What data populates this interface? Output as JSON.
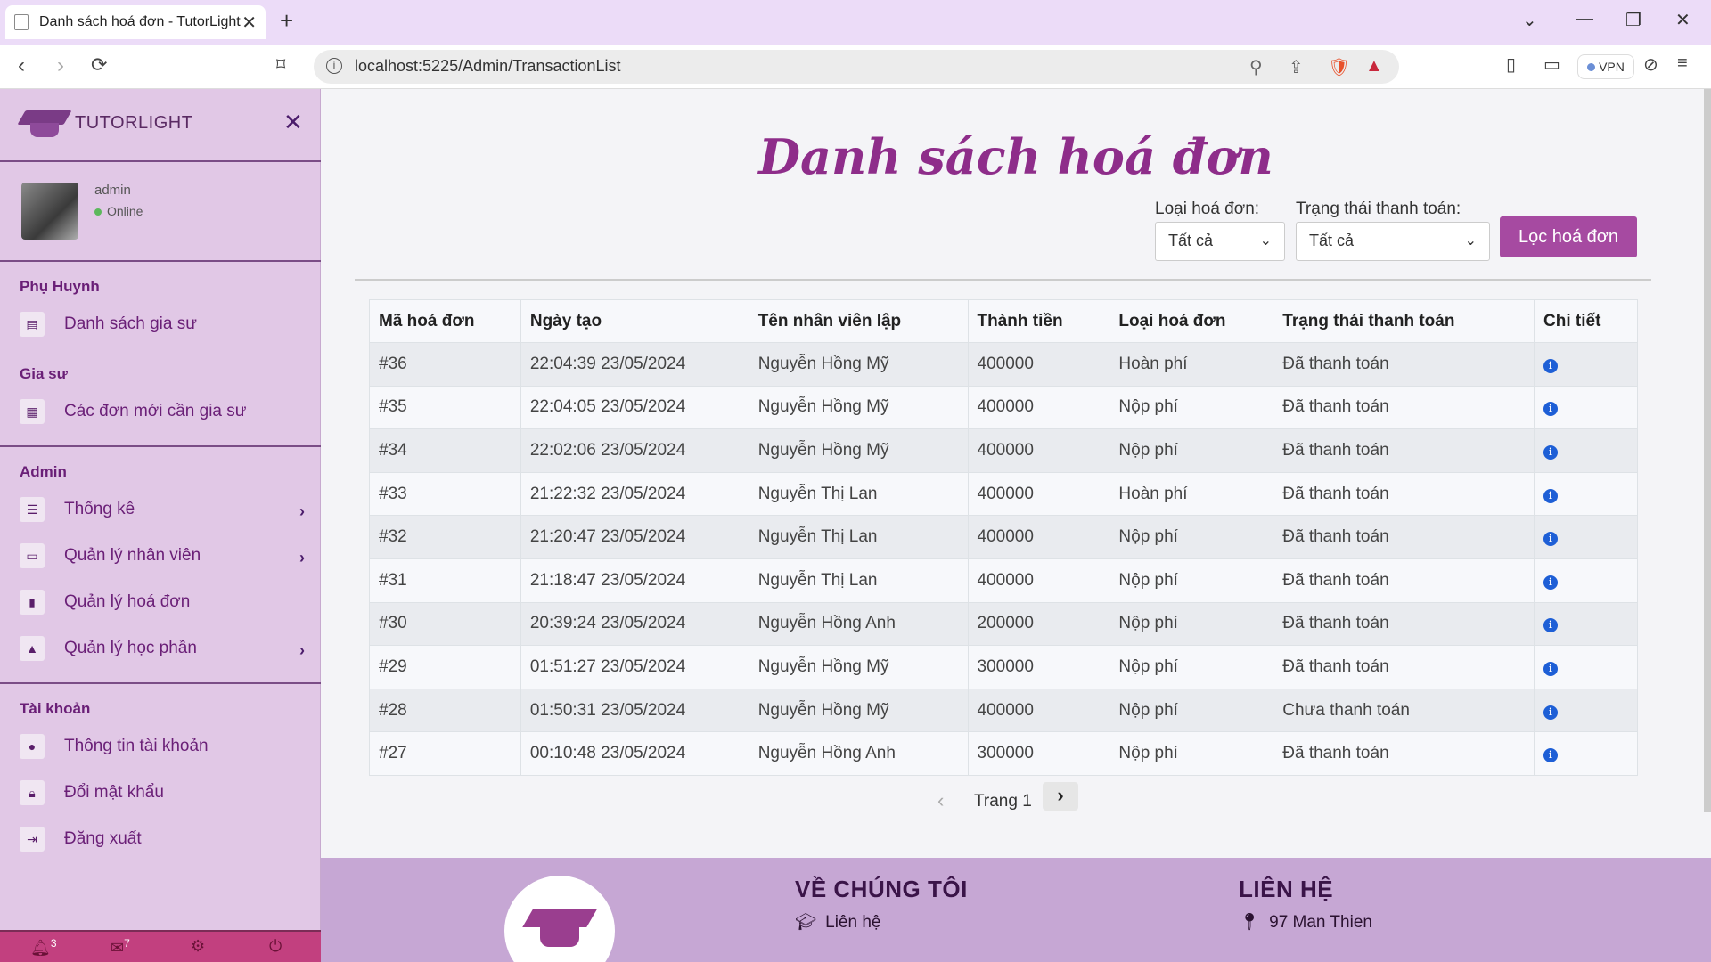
{
  "browser": {
    "tab_title": "Danh sách hoá đơn - TutorLight",
    "url": "localhost:5225/Admin/TransactionList",
    "vpn_label": "VPN"
  },
  "sidebar": {
    "brand": "TUTORLIGHT",
    "user_name": "admin",
    "user_status": "Online",
    "sections": [
      {
        "title": "Phụ Huynh",
        "items": [
          {
            "label": "Danh sách gia sư"
          }
        ]
      },
      {
        "title": "Gia sư",
        "items": [
          {
            "label": "Các đơn mới cần gia sư"
          }
        ]
      },
      {
        "title": "Admin",
        "items": [
          {
            "label": "Thống kê"
          },
          {
            "label": "Quản lý nhân viên"
          },
          {
            "label": "Quản lý hoá đơn"
          },
          {
            "label": "Quản lý học phần"
          }
        ]
      },
      {
        "title": "Tài khoản",
        "items": [
          {
            "label": "Thông tin tài khoản"
          },
          {
            "label": "Đổi mật khẩu"
          },
          {
            "label": "Đăng xuất"
          }
        ]
      }
    ],
    "footer": {
      "notifications_count": "3",
      "messages_count": "7"
    }
  },
  "main": {
    "title": "Danh sách hoá đơn",
    "filters": {
      "type_label": "Loại hoá đơn:",
      "type_value": "Tất cả",
      "status_label": "Trạng thái thanh toán:",
      "status_value": "Tất cả",
      "submit_label": "Lọc hoá đơn"
    },
    "table": {
      "headers": [
        "Mã hoá đơn",
        "Ngày tạo",
        "Tên nhân viên lập",
        "Thành tiền",
        "Loại hoá đơn",
        "Trạng thái thanh toán",
        "Chi tiết"
      ],
      "rows": [
        [
          "#36",
          "22:04:39 23/05/2024",
          "Nguyễn Hồng Mỹ",
          "400000",
          "Hoàn phí",
          "Đã thanh toán"
        ],
        [
          "#35",
          "22:04:05 23/05/2024",
          "Nguyễn Hồng Mỹ",
          "400000",
          "Nộp phí",
          "Đã thanh toán"
        ],
        [
          "#34",
          "22:02:06 23/05/2024",
          "Nguyễn Hồng Mỹ",
          "400000",
          "Nộp phí",
          "Đã thanh toán"
        ],
        [
          "#33",
          "21:22:32 23/05/2024",
          "Nguyễn Thị Lan",
          "400000",
          "Hoàn phí",
          "Đã thanh toán"
        ],
        [
          "#32",
          "21:20:47 23/05/2024",
          "Nguyễn Thị Lan",
          "400000",
          "Nộp phí",
          "Đã thanh toán"
        ],
        [
          "#31",
          "21:18:47 23/05/2024",
          "Nguyễn Thị Lan",
          "400000",
          "Nộp phí",
          "Đã thanh toán"
        ],
        [
          "#30",
          "20:39:24 23/05/2024",
          "Nguyễn Hồng Anh",
          "200000",
          "Nộp phí",
          "Đã thanh toán"
        ],
        [
          "#29",
          "01:51:27 23/05/2024",
          "Nguyễn Hồng Mỹ",
          "300000",
          "Nộp phí",
          "Đã thanh toán"
        ],
        [
          "#28",
          "01:50:31 23/05/2024",
          "Nguyễn Hồng Mỹ",
          "400000",
          "Nộp phí",
          "Chưa thanh toán"
        ],
        [
          "#27",
          "00:10:48 23/05/2024",
          "Nguyễn Hồng Anh",
          "300000",
          "Nộp phí",
          "Đã thanh toán"
        ]
      ]
    },
    "pager": {
      "label": "Trang 1"
    }
  },
  "footer": {
    "about_title": "VỀ CHÚNG TÔI",
    "about_link": "Liên hệ",
    "contact_title": "LIÊN HỆ",
    "contact_address": "97 Man Thien"
  }
}
